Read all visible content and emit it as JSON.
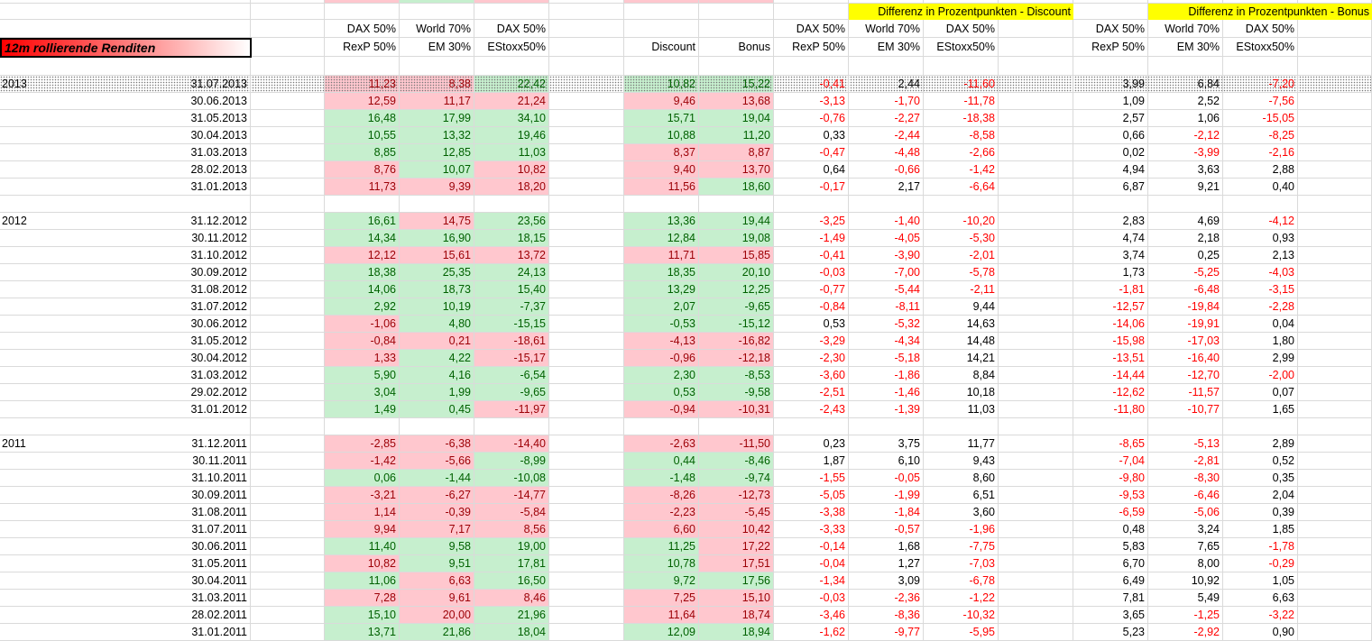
{
  "header": {
    "title": "12m rollierende Renditen",
    "diff_discount": "Differenz in Prozentpunkten -  Discount",
    "diff_bonus": "Differenz in Prozentpunkten -  Bonus",
    "portfolio_line1": [
      "DAX 50%",
      "World 70%",
      "DAX 50%"
    ],
    "portfolio_line2": [
      "RexP 50%",
      "EM 30%",
      "EStoxx50%"
    ],
    "discount": "Discount",
    "bonus": "Bonus"
  },
  "colors": {
    "green_fill": "#c6efce",
    "green_text": "#006100",
    "red_fill": "#ffc7ce",
    "red_text": "#9c0006",
    "negative": "#ff0000",
    "highlight": "#ffff00"
  },
  "groups": [
    {
      "year": "2013",
      "rows": [
        {
          "date": "31.07.2013",
          "p": [
            "11,23",
            "8,38",
            "22,42"
          ],
          "pc": "RRG",
          "s": [
            "10,82",
            "15,22"
          ],
          "sc": "GG",
          "dd": [
            "-0,41",
            "2,44",
            "-11,60"
          ],
          "db": [
            "3,99",
            "6,84",
            "-7,20"
          ]
        },
        {
          "date": "30.06.2013",
          "p": [
            "12,59",
            "11,17",
            "21,24"
          ],
          "pc": "RRR",
          "s": [
            "9,46",
            "13,68"
          ],
          "sc": "RR",
          "dd": [
            "-3,13",
            "-1,70",
            "-11,78"
          ],
          "db": [
            "1,09",
            "2,52",
            "-7,56"
          ]
        },
        {
          "date": "31.05.2013",
          "p": [
            "16,48",
            "17,99",
            "34,10"
          ],
          "pc": "GGG",
          "s": [
            "15,71",
            "19,04"
          ],
          "sc": "GG",
          "dd": [
            "-0,76",
            "-2,27",
            "-18,38"
          ],
          "db": [
            "2,57",
            "1,06",
            "-15,05"
          ]
        },
        {
          "date": "30.04.2013",
          "p": [
            "10,55",
            "13,32",
            "19,46"
          ],
          "pc": "GGG",
          "s": [
            "10,88",
            "11,20"
          ],
          "sc": "GG",
          "dd": [
            "0,33",
            "-2,44",
            "-8,58"
          ],
          "db": [
            "0,66",
            "-2,12",
            "-8,25"
          ]
        },
        {
          "date": "31.03.2013",
          "p": [
            "8,85",
            "12,85",
            "11,03"
          ],
          "pc": "GGG",
          "s": [
            "8,37",
            "8,87"
          ],
          "sc": "RR",
          "dd": [
            "-0,47",
            "-4,48",
            "-2,66"
          ],
          "db": [
            "0,02",
            "-3,99",
            "-2,16"
          ]
        },
        {
          "date": "28.02.2013",
          "p": [
            "8,76",
            "10,07",
            "10,82"
          ],
          "pc": "RGR",
          "s": [
            "9,40",
            "13,70"
          ],
          "sc": "RR",
          "dd": [
            "0,64",
            "-0,66",
            "-1,42"
          ],
          "db": [
            "4,94",
            "3,63",
            "2,88"
          ]
        },
        {
          "date": "31.01.2013",
          "p": [
            "11,73",
            "9,39",
            "18,20"
          ],
          "pc": "RRR",
          "s": [
            "11,56",
            "18,60"
          ],
          "sc": "RG",
          "dd": [
            "-0,17",
            "2,17",
            "-6,64"
          ],
          "db": [
            "6,87",
            "9,21",
            "0,40"
          ]
        }
      ]
    },
    {
      "year": "2012",
      "rows": [
        {
          "date": "31.12.2012",
          "p": [
            "16,61",
            "14,75",
            "23,56"
          ],
          "pc": "GRG",
          "s": [
            "13,36",
            "19,44"
          ],
          "sc": "GG",
          "dd": [
            "-3,25",
            "-1,40",
            "-10,20"
          ],
          "db": [
            "2,83",
            "4,69",
            "-4,12"
          ]
        },
        {
          "date": "30.11.2012",
          "p": [
            "14,34",
            "16,90",
            "18,15"
          ],
          "pc": "GGG",
          "s": [
            "12,84",
            "19,08"
          ],
          "sc": "GG",
          "dd": [
            "-1,49",
            "-4,05",
            "-5,30"
          ],
          "db": [
            "4,74",
            "2,18",
            "0,93"
          ]
        },
        {
          "date": "31.10.2012",
          "p": [
            "12,12",
            "15,61",
            "13,72"
          ],
          "pc": "RRR",
          "s": [
            "11,71",
            "15,85"
          ],
          "sc": "RR",
          "dd": [
            "-0,41",
            "-3,90",
            "-2,01"
          ],
          "db": [
            "3,74",
            "0,25",
            "2,13"
          ]
        },
        {
          "date": "30.09.2012",
          "p": [
            "18,38",
            "25,35",
            "24,13"
          ],
          "pc": "GGG",
          "s": [
            "18,35",
            "20,10"
          ],
          "sc": "GG",
          "dd": [
            "-0,03",
            "-7,00",
            "-5,78"
          ],
          "db": [
            "1,73",
            "-5,25",
            "-4,03"
          ]
        },
        {
          "date": "31.08.2012",
          "p": [
            "14,06",
            "18,73",
            "15,40"
          ],
          "pc": "GGG",
          "s": [
            "13,29",
            "12,25"
          ],
          "sc": "GG",
          "dd": [
            "-0,77",
            "-5,44",
            "-2,11"
          ],
          "db": [
            "-1,81",
            "-6,48",
            "-3,15"
          ]
        },
        {
          "date": "31.07.2012",
          "p": [
            "2,92",
            "10,19",
            "-7,37"
          ],
          "pc": "GGG",
          "s": [
            "2,07",
            "-9,65"
          ],
          "sc": "GG",
          "dd": [
            "-0,84",
            "-8,11",
            "9,44"
          ],
          "db": [
            "-12,57",
            "-19,84",
            "-2,28"
          ]
        },
        {
          "date": "30.06.2012",
          "p": [
            "-1,06",
            "4,80",
            "-15,15"
          ],
          "pc": "RGG",
          "s": [
            "-0,53",
            "-15,12"
          ],
          "sc": "GG",
          "dd": [
            "0,53",
            "-5,32",
            "14,63"
          ],
          "db": [
            "-14,06",
            "-19,91",
            "0,04"
          ]
        },
        {
          "date": "31.05.2012",
          "p": [
            "-0,84",
            "0,21",
            "-18,61"
          ],
          "pc": "RRR",
          "s": [
            "-4,13",
            "-16,82"
          ],
          "sc": "RR",
          "dd": [
            "-3,29",
            "-4,34",
            "14,48"
          ],
          "db": [
            "-15,98",
            "-17,03",
            "1,80"
          ]
        },
        {
          "date": "30.04.2012",
          "p": [
            "1,33",
            "4,22",
            "-15,17"
          ],
          "pc": "RGR",
          "s": [
            "-0,96",
            "-12,18"
          ],
          "sc": "RR",
          "dd": [
            "-2,30",
            "-5,18",
            "14,21"
          ],
          "db": [
            "-13,51",
            "-16,40",
            "2,99"
          ]
        },
        {
          "date": "31.03.2012",
          "p": [
            "5,90",
            "4,16",
            "-6,54"
          ],
          "pc": "GGG",
          "s": [
            "2,30",
            "-8,53"
          ],
          "sc": "GG",
          "dd": [
            "-3,60",
            "-1,86",
            "8,84"
          ],
          "db": [
            "-14,44",
            "-12,70",
            "-2,00"
          ]
        },
        {
          "date": "29.02.2012",
          "p": [
            "3,04",
            "1,99",
            "-9,65"
          ],
          "pc": "GGG",
          "s": [
            "0,53",
            "-9,58"
          ],
          "sc": "GG",
          "dd": [
            "-2,51",
            "-1,46",
            "10,18"
          ],
          "db": [
            "-12,62",
            "-11,57",
            "0,07"
          ]
        },
        {
          "date": "31.01.2012",
          "p": [
            "1,49",
            "0,45",
            "-11,97"
          ],
          "pc": "GGR",
          "s": [
            "-0,94",
            "-10,31"
          ],
          "sc": "RR",
          "dd": [
            "-2,43",
            "-1,39",
            "11,03"
          ],
          "db": [
            "-11,80",
            "-10,77",
            "1,65"
          ]
        }
      ]
    },
    {
      "year": "2011",
      "rows": [
        {
          "date": "31.12.2011",
          "p": [
            "-2,85",
            "-6,38",
            "-14,40"
          ],
          "pc": "RRR",
          "s": [
            "-2,63",
            "-11,50"
          ],
          "sc": "RR",
          "dd": [
            "0,23",
            "3,75",
            "11,77"
          ],
          "db": [
            "-8,65",
            "-5,13",
            "2,89"
          ]
        },
        {
          "date": "30.11.2011",
          "p": [
            "-1,42",
            "-5,66",
            "-8,99"
          ],
          "pc": "RRG",
          "s": [
            "0,44",
            "-8,46"
          ],
          "sc": "GG",
          "dd": [
            "1,87",
            "6,10",
            "9,43"
          ],
          "db": [
            "-7,04",
            "-2,81",
            "0,52"
          ]
        },
        {
          "date": "31.10.2011",
          "p": [
            "0,06",
            "-1,44",
            "-10,08"
          ],
          "pc": "GGG",
          "s": [
            "-1,48",
            "-9,74"
          ],
          "sc": "GG",
          "dd": [
            "-1,55",
            "-0,05",
            "8,60"
          ],
          "db": [
            "-9,80",
            "-8,30",
            "0,35"
          ]
        },
        {
          "date": "30.09.2011",
          "p": [
            "-3,21",
            "-6,27",
            "-14,77"
          ],
          "pc": "RRR",
          "s": [
            "-8,26",
            "-12,73"
          ],
          "sc": "RR",
          "dd": [
            "-5,05",
            "-1,99",
            "6,51"
          ],
          "db": [
            "-9,53",
            "-6,46",
            "2,04"
          ]
        },
        {
          "date": "31.08.2011",
          "p": [
            "1,14",
            "-0,39",
            "-5,84"
          ],
          "pc": "RRR",
          "s": [
            "-2,23",
            "-5,45"
          ],
          "sc": "RR",
          "dd": [
            "-3,38",
            "-1,84",
            "3,60"
          ],
          "db": [
            "-6,59",
            "-5,06",
            "0,39"
          ]
        },
        {
          "date": "31.07.2011",
          "p": [
            "9,94",
            "7,17",
            "8,56"
          ],
          "pc": "RRR",
          "s": [
            "6,60",
            "10,42"
          ],
          "sc": "RR",
          "dd": [
            "-3,33",
            "-0,57",
            "-1,96"
          ],
          "db": [
            "0,48",
            "3,24",
            "1,85"
          ]
        },
        {
          "date": "30.06.2011",
          "p": [
            "11,40",
            "9,58",
            "19,00"
          ],
          "pc": "GGG",
          "s": [
            "11,25",
            "17,22"
          ],
          "sc": "GR",
          "dd": [
            "-0,14",
            "1,68",
            "-7,75"
          ],
          "db": [
            "5,83",
            "7,65",
            "-1,78"
          ]
        },
        {
          "date": "31.05.2011",
          "p": [
            "10,82",
            "9,51",
            "17,81"
          ],
          "pc": "RGG",
          "s": [
            "10,78",
            "17,51"
          ],
          "sc": "GR",
          "dd": [
            "-0,04",
            "1,27",
            "-7,03"
          ],
          "db": [
            "6,70",
            "8,00",
            "-0,29"
          ]
        },
        {
          "date": "30.04.2011",
          "p": [
            "11,06",
            "6,63",
            "16,50"
          ],
          "pc": "GRG",
          "s": [
            "9,72",
            "17,56"
          ],
          "sc": "GG",
          "dd": [
            "-1,34",
            "3,09",
            "-6,78"
          ],
          "db": [
            "6,49",
            "10,92",
            "1,05"
          ]
        },
        {
          "date": "31.03.2011",
          "p": [
            "7,28",
            "9,61",
            "8,46"
          ],
          "pc": "RRR",
          "s": [
            "7,25",
            "15,10"
          ],
          "sc": "RR",
          "dd": [
            "-0,03",
            "-2,36",
            "-1,22"
          ],
          "db": [
            "7,81",
            "5,49",
            "6,63"
          ]
        },
        {
          "date": "28.02.2011",
          "p": [
            "15,10",
            "20,00",
            "21,96"
          ],
          "pc": "GRG",
          "s": [
            "11,64",
            "18,74"
          ],
          "sc": "RR",
          "dd": [
            "-3,46",
            "-8,36",
            "-10,32"
          ],
          "db": [
            "3,65",
            "-1,25",
            "-3,22"
          ]
        },
        {
          "date": "31.01.2011",
          "p": [
            "13,71",
            "21,86",
            "18,04"
          ],
          "pc": "GGG",
          "s": [
            "12,09",
            "18,94"
          ],
          "sc": "GG",
          "dd": [
            "-1,62",
            "-9,77",
            "-5,95"
          ],
          "db": [
            "5,23",
            "-2,92",
            "0,90"
          ]
        }
      ]
    }
  ]
}
